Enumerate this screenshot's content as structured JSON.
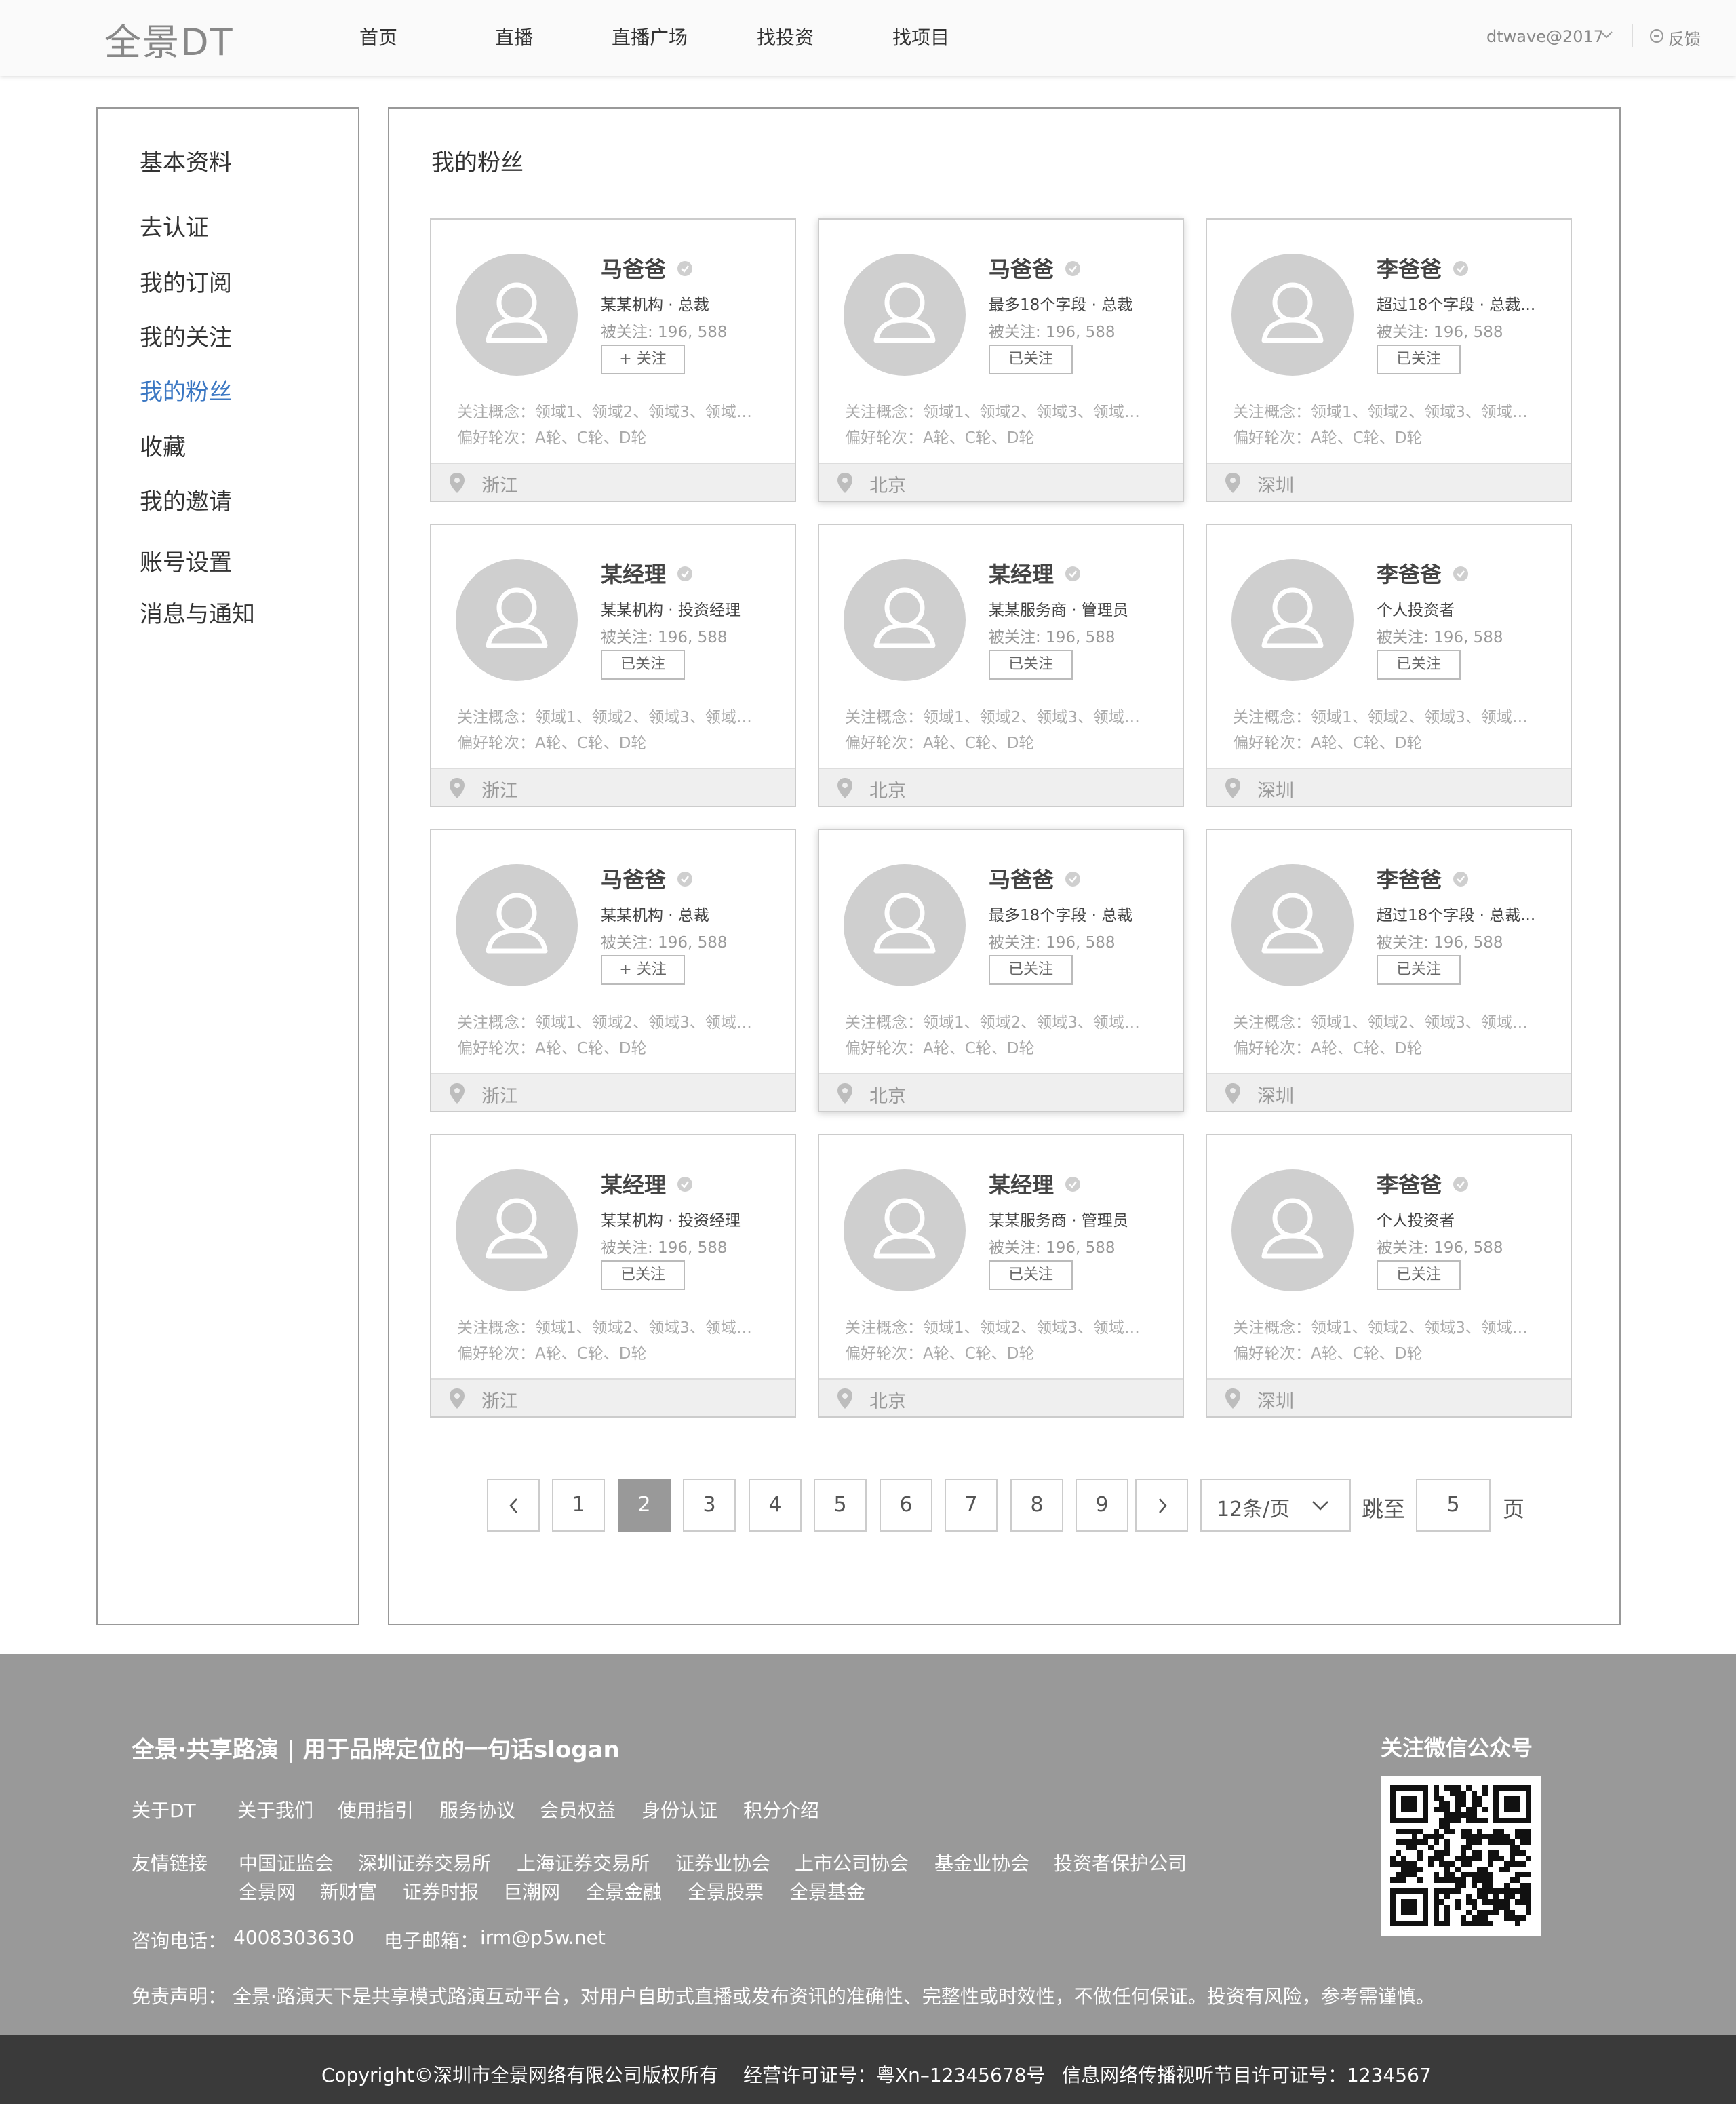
{
  "header": {
    "logo": "全景DT",
    "nav": [
      "首页",
      "直播",
      "直播广场",
      "找投资",
      "找项目"
    ],
    "user": "dtwave@2017",
    "feedback": "反馈"
  },
  "sidebar": {
    "items": [
      {
        "label": "基本资料"
      },
      {
        "label": "去认证"
      },
      {
        "label": "我的订阅"
      },
      {
        "label": "我的关注"
      },
      {
        "label": "我的粉丝",
        "active": true
      },
      {
        "label": "收藏"
      },
      {
        "label": "我的邀请"
      },
      {
        "label": "账号设置"
      },
      {
        "label": "消息与通知"
      }
    ]
  },
  "main": {
    "title": "我的粉丝",
    "cards": [
      {
        "name": "马爸爸",
        "title": "某某机构 · 总裁",
        "count": "被关注: 196, 588",
        "button": "+ 关注",
        "concept": "关注概念：领域1、领域2、领域3、领域…",
        "rounds": "偏好轮次：A轮、C轮、D轮",
        "location": "浙江"
      },
      {
        "name": "马爸爸",
        "title": "最多18个字段 · 总裁",
        "count": "被关注: 196, 588",
        "button": "已关注",
        "concept": "关注概念：领域1、领域2、领域3、领域…",
        "rounds": "偏好轮次：A轮、C轮、D轮",
        "location": "北京"
      },
      {
        "name": "李爸爸",
        "title": "超过18个字段 · 总裁...",
        "count": "被关注: 196, 588",
        "button": "已关注",
        "concept": "关注概念：领域1、领域2、领域3、领域…",
        "rounds": "偏好轮次：A轮、C轮、D轮",
        "location": "深圳"
      },
      {
        "name": "某经理",
        "title": "某某机构 · 投资经理",
        "count": "被关注: 196, 588",
        "button": "已关注",
        "concept": "关注概念：领域1、领域2、领域3、领域…",
        "rounds": "偏好轮次：A轮、C轮、D轮",
        "location": "浙江"
      },
      {
        "name": "某经理",
        "title": "某某服务商 · 管理员",
        "count": "被关注: 196, 588",
        "button": "已关注",
        "concept": "关注概念：领域1、领域2、领域3、领域…",
        "rounds": "偏好轮次：A轮、C轮、D轮",
        "location": "北京"
      },
      {
        "name": "李爸爸",
        "title": "个人投资者",
        "count": "被关注: 196, 588",
        "button": "已关注",
        "concept": "关注概念：领域1、领域2、领域3、领域…",
        "rounds": "偏好轮次：A轮、C轮、D轮",
        "location": "深圳"
      },
      {
        "name": "马爸爸",
        "title": "某某机构 · 总裁",
        "count": "被关注: 196, 588",
        "button": "+ 关注",
        "concept": "关注概念：领域1、领域2、领域3、领域…",
        "rounds": "偏好轮次：A轮、C轮、D轮",
        "location": "浙江"
      },
      {
        "name": "马爸爸",
        "title": "最多18个字段 · 总裁",
        "count": "被关注: 196, 588",
        "button": "已关注",
        "concept": "关注概念：领域1、领域2、领域3、领域…",
        "rounds": "偏好轮次：A轮、C轮、D轮",
        "location": "北京"
      },
      {
        "name": "李爸爸",
        "title": "超过18个字段 · 总裁...",
        "count": "被关注: 196, 588",
        "button": "已关注",
        "concept": "关注概念：领域1、领域2、领域3、领域…",
        "rounds": "偏好轮次：A轮、C轮、D轮",
        "location": "深圳"
      },
      {
        "name": "某经理",
        "title": "某某机构 · 投资经理",
        "count": "被关注: 196, 588",
        "button": "已关注",
        "concept": "关注概念：领域1、领域2、领域3、领域…",
        "rounds": "偏好轮次：A轮、C轮、D轮",
        "location": "浙江"
      },
      {
        "name": "某经理",
        "title": "某某服务商 · 管理员",
        "count": "被关注: 196, 588",
        "button": "已关注",
        "concept": "关注概念：领域1、领域2、领域3、领域…",
        "rounds": "偏好轮次：A轮、C轮、D轮",
        "location": "北京"
      },
      {
        "name": "李爸爸",
        "title": "个人投资者",
        "count": "被关注: 196, 588",
        "button": "已关注",
        "concept": "关注概念：领域1、领域2、领域3、领域…",
        "rounds": "偏好轮次：A轮、C轮、D轮",
        "location": "深圳"
      }
    ]
  },
  "pagination": {
    "pages": [
      "1",
      "2",
      "3",
      "4",
      "5",
      "6",
      "7",
      "8",
      "9"
    ],
    "current": "2",
    "page_size": "12条/页",
    "jump_label": "跳至",
    "jump_value": "5",
    "page_suffix": "页"
  },
  "footer": {
    "slogan": "全景·共享路演 | 用于品牌定位的一句话slogan",
    "about_label": "关于DT",
    "about_links": [
      "关于我们",
      "使用指引",
      "服务协议",
      "会员权益",
      "身份认证",
      "积分介绍"
    ],
    "friend_label": "友情链接",
    "friend_links_row1": [
      "中国证监会",
      "深圳证券交易所",
      "上海证券交易所",
      "证券业协会",
      "上市公司协会",
      "基金业协会",
      "投资者保护公司"
    ],
    "friend_links_row2": [
      "全景网",
      "新财富",
      "证券时报",
      "巨潮网",
      "全景金融",
      "全景股票",
      "全景基金"
    ],
    "phone_label": "咨询电话：",
    "phone": "4008303630",
    "email_label": "电子邮箱：",
    "email": "irm@p5w.net",
    "disclaimer": "免责声明：  全景·路演天下是共享模式路演互动平台，对用户自助式直播或发布资讯的准确性、完整性或时效性，不做任何保证。投资有风险，参考需谨慎。",
    "wechat": "关注微信公众号"
  },
  "bottom": {
    "copyright": "Copyright©深圳市全景网络有限公司版权所有",
    "license": "经营许可证号：粤Xn–12345678号",
    "broadcast": "信息网络传播视听节目许可证号：1234567"
  },
  "colors": {
    "accent": "#3c78c3",
    "footer_bg": "#999999",
    "bottom_bar": "#3a3a3a",
    "pager_active": "#999999"
  }
}
